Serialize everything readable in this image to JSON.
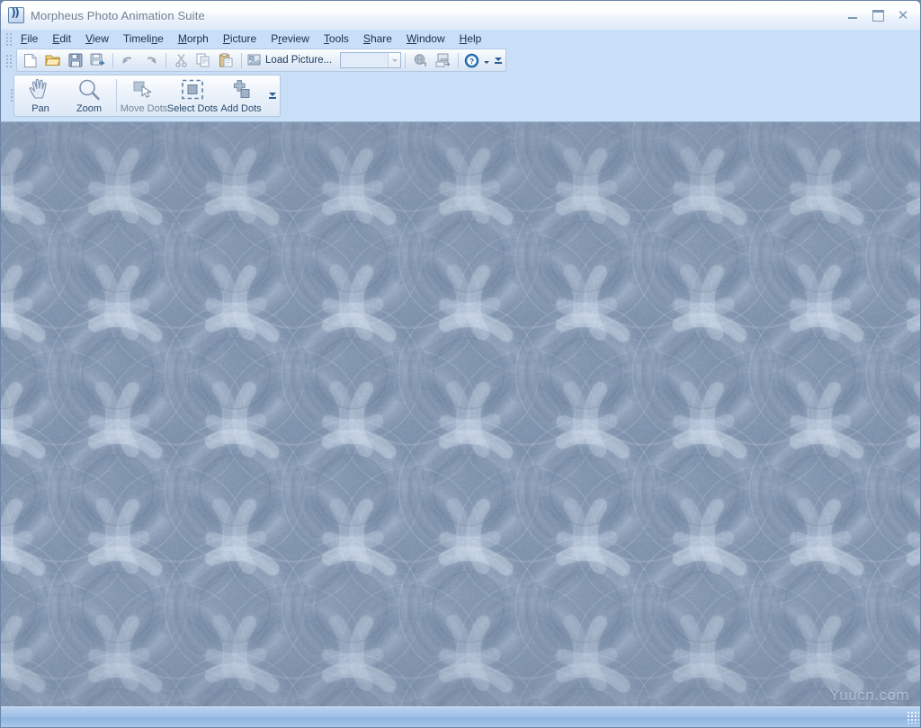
{
  "window": {
    "title": "Morpheus Photo Animation Suite",
    "icon": "app-icon",
    "minimize_label": "",
    "maximize_label": "",
    "close_label": "✕"
  },
  "menubar": {
    "items": [
      {
        "label": "File",
        "accel_index": 0
      },
      {
        "label": "Edit",
        "accel_index": 0
      },
      {
        "label": "View",
        "accel_index": 0
      },
      {
        "label": "Timeline",
        "accel_index": 6
      },
      {
        "label": "Morph",
        "accel_index": 0
      },
      {
        "label": "Picture",
        "accel_index": 0
      },
      {
        "label": "Preview",
        "accel_index": 1
      },
      {
        "label": "Tools",
        "accel_index": 0
      },
      {
        "label": "Share",
        "accel_index": 0
      },
      {
        "label": "Window",
        "accel_index": 0
      },
      {
        "label": "Help",
        "accel_index": 0
      }
    ]
  },
  "toolbar_main": {
    "buttons": [
      {
        "name": "new-icon",
        "tooltip": "New"
      },
      {
        "name": "open-icon",
        "tooltip": "Open"
      },
      {
        "name": "save-icon",
        "tooltip": "Save"
      },
      {
        "name": "save-as-icon",
        "tooltip": "Save As"
      },
      {
        "name": "undo-icon",
        "tooltip": "Undo"
      },
      {
        "name": "redo-icon",
        "tooltip": "Redo"
      },
      {
        "name": "cut-icon",
        "tooltip": "Cut"
      },
      {
        "name": "copy-icon",
        "tooltip": "Copy"
      },
      {
        "name": "paste-icon",
        "tooltip": "Paste"
      }
    ],
    "load_picture_label": "Load Picture...",
    "load_picture_accel_index": 1,
    "combo_value": "",
    "combo_placeholder": "",
    "right_buttons": [
      {
        "name": "web-preview-icon",
        "tooltip": "Preview in Browser"
      },
      {
        "name": "export-icon",
        "tooltip": "Export"
      }
    ],
    "help_label": "?",
    "overflow_label": ""
  },
  "toolbar_tools": {
    "buttons": [
      {
        "label": "Pan",
        "icon": "hand-icon",
        "enabled": true
      },
      {
        "label": "Zoom",
        "icon": "magnifier-icon",
        "enabled": true
      },
      {
        "label": "Move Dots",
        "icon": "move-dots-icon",
        "enabled": false
      },
      {
        "label": "Select Dots",
        "icon": "select-dots-icon",
        "enabled": true
      },
      {
        "label": "Add Dots",
        "icon": "add-dots-icon",
        "enabled": true
      }
    ]
  },
  "canvas": {
    "watermark": "Yuucn.com",
    "background_colors": {
      "base": "#8295ae",
      "dark": "#6d82a0",
      "light": "#c3d2e4",
      "highlight": "#dfe8f3"
    },
    "tile_size": 130
  },
  "statusbar": {
    "text": "",
    "grip": "resize-grip"
  }
}
